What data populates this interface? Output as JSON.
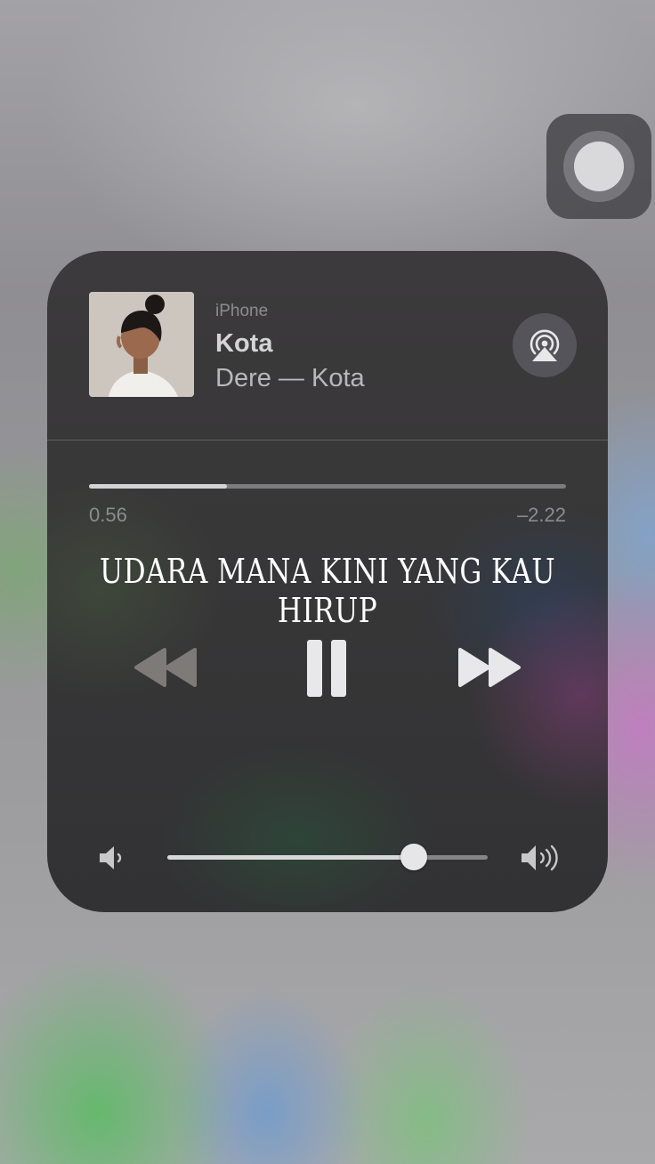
{
  "now_playing": {
    "source": "iPhone",
    "title": "Kota",
    "subtitle": "Dere — Kota",
    "elapsed": "0.56",
    "remaining": "–2.22",
    "progress": 0.29
  },
  "lyric": "UDARA MANA KINI YANG KAU HIRUP",
  "volume": {
    "level": 0.77
  },
  "icons": {
    "corner": "screen-record-icon",
    "airplay": "airplay-audio-icon",
    "rewind": "rewind-icon",
    "pause": "pause-icon",
    "forward": "fast-forward-icon",
    "volume_low": "speaker-low-icon",
    "volume_high": "speaker-high-icon"
  },
  "colors": {
    "panel": "#3a393b",
    "control": "#e8e8ea",
    "control_disabled": "#7e7a78"
  }
}
